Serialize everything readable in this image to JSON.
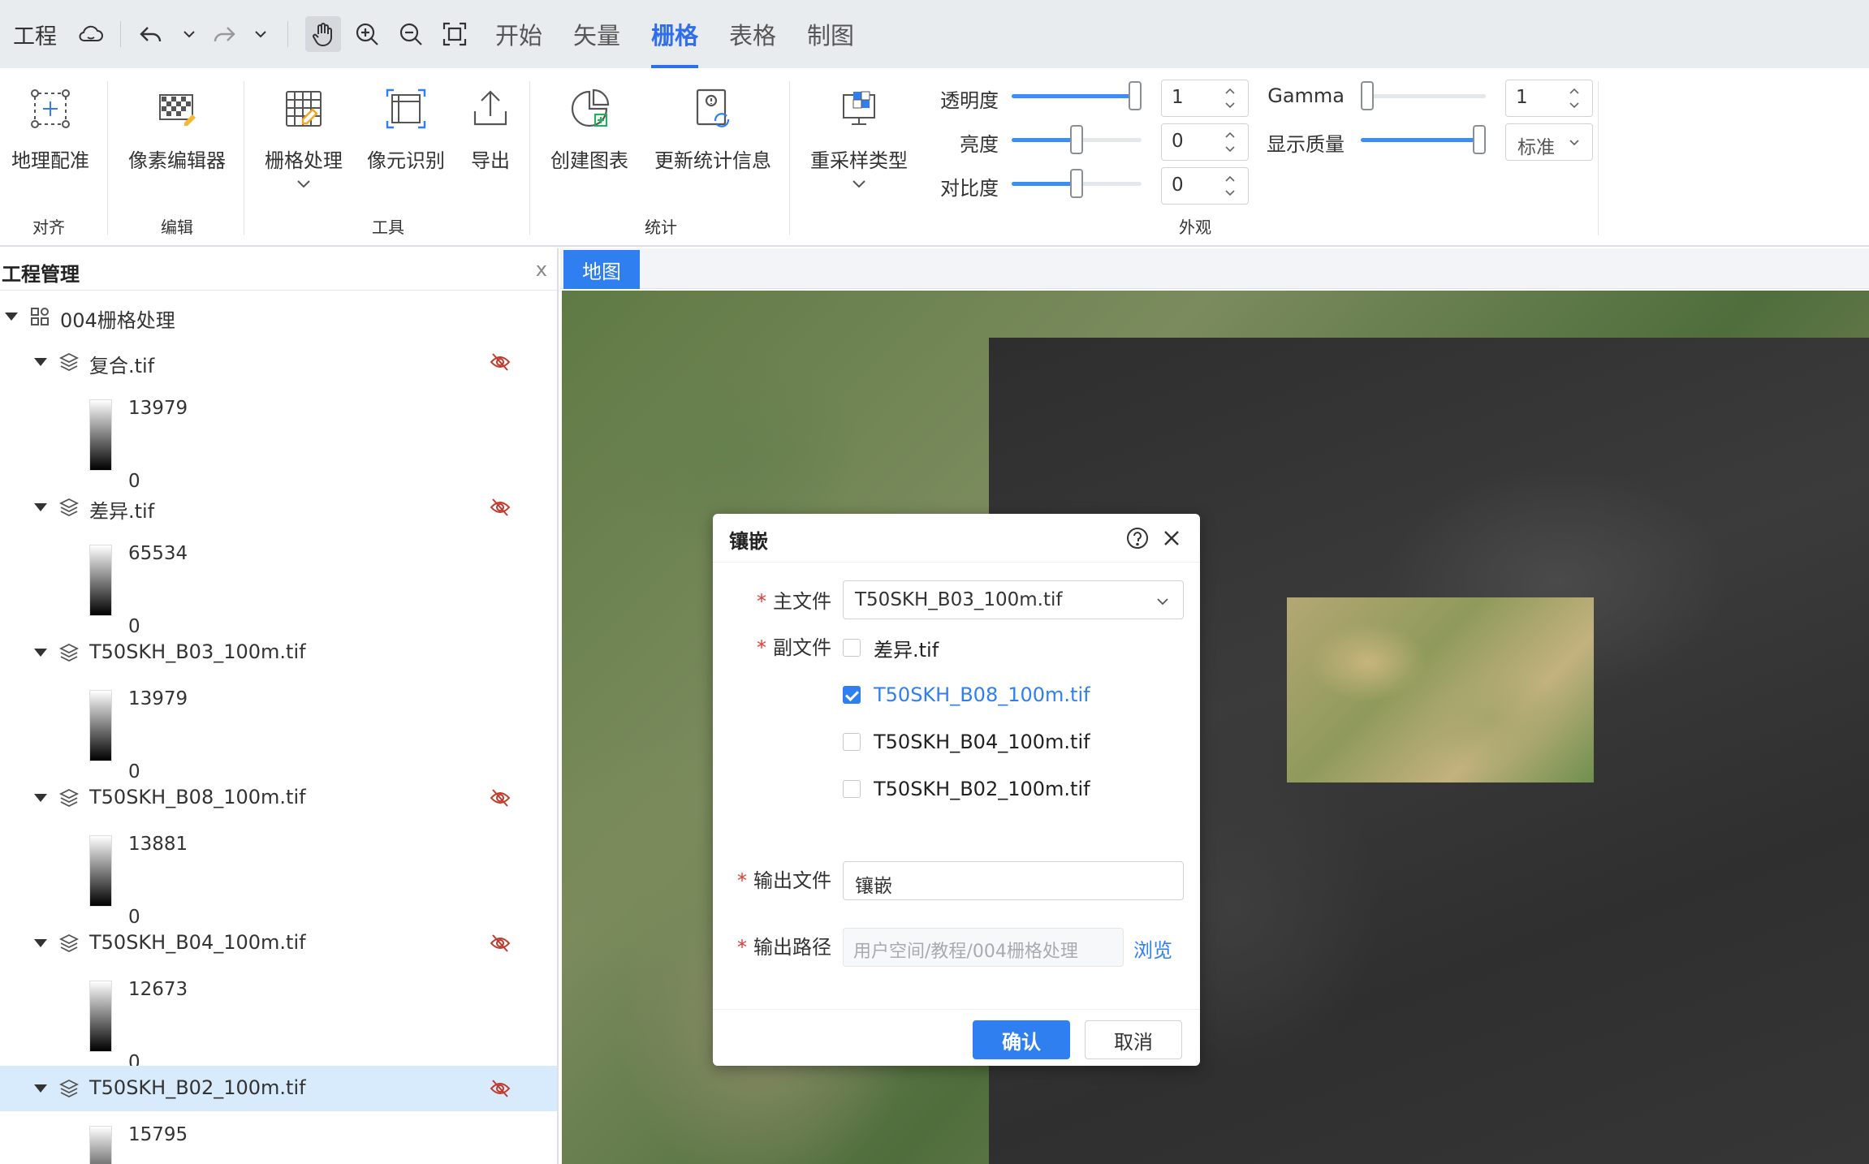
{
  "topbar": {
    "project_label": "工程",
    "menu": [
      "开始",
      "矢量",
      "栅格",
      "表格",
      "制图"
    ],
    "active_menu": "栅格"
  },
  "ribbon": {
    "buttons": {
      "geo_register": "地理配准",
      "pixel_editor": "像素编辑器",
      "raster_process": "栅格处理",
      "pixel_recognition": "像元识别",
      "export": "导出",
      "create_chart": "创建图表",
      "update_stats": "更新统计信息",
      "resample_type": "重采样类型"
    },
    "groups": {
      "align": "对齐",
      "edit": "编辑",
      "tools": "工具",
      "stats": "统计",
      "appearance": "外观"
    },
    "appearance": {
      "transparency": {
        "label": "透明度",
        "value": "1",
        "level": 1.0
      },
      "brightness": {
        "label": "亮度",
        "value": "0",
        "level": 0.5
      },
      "contrast": {
        "label": "对比度",
        "value": "0",
        "level": 0.5
      },
      "gamma": {
        "label": "Gamma",
        "value": "1",
        "level": 0.0
      },
      "display_quality": {
        "label": "显示质量",
        "value": "标准",
        "level": 1.0
      }
    }
  },
  "project_panel": {
    "title": "工程管理",
    "close": "x",
    "root": "004栅格处理",
    "layers": [
      {
        "name": "复合.tif",
        "max": "13979",
        "min": "0",
        "hidden": true
      },
      {
        "name": "差异.tif",
        "max": "65534",
        "min": "0",
        "hidden": true
      },
      {
        "name": "T50SKH_B03_100m.tif",
        "max": "13979",
        "min": "0",
        "hidden": false
      },
      {
        "name": "T50SKH_B08_100m.tif",
        "max": "13881",
        "min": "0",
        "hidden": true
      },
      {
        "name": "T50SKH_B04_100m.tif",
        "max": "12673",
        "min": "0",
        "hidden": true
      },
      {
        "name": "T50SKH_B02_100m.tif",
        "max": "15795",
        "min": "",
        "hidden": true
      }
    ]
  },
  "map": {
    "tab": "地图"
  },
  "dialog": {
    "title": "镶嵌",
    "main_file_label": "主文件",
    "main_file_value": "T50SKH_B03_100m.tif",
    "sub_file_label": "副文件",
    "sub_files": [
      {
        "name": "差异.tif",
        "checked": false
      },
      {
        "name": "T50SKH_B08_100m.tif",
        "checked": true
      },
      {
        "name": "T50SKH_B04_100m.tif",
        "checked": false
      },
      {
        "name": "T50SKH_B02_100m.tif",
        "checked": false
      }
    ],
    "output_file_label": "输出文件",
    "output_file_value": "镶嵌",
    "output_path_label": "输出路径",
    "output_path_placeholder": "用户空间/教程/004栅格处理",
    "browse": "浏览",
    "ok": "确认",
    "cancel": "取消"
  }
}
